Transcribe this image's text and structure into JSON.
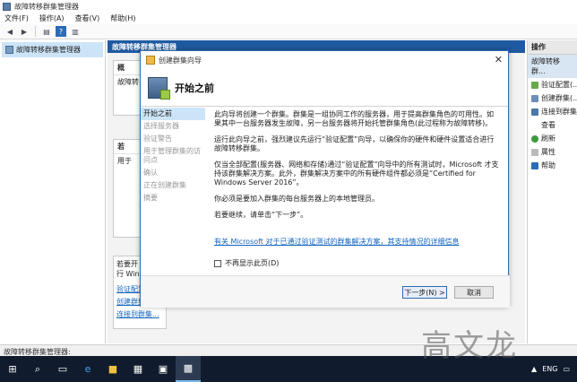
{
  "window": {
    "title": "故障转移群集管理器"
  },
  "menu": [
    "文件(F)",
    "操作(A)",
    "查看(V)",
    "帮助(H)"
  ],
  "tree": {
    "root": "故障转移群集管理器"
  },
  "center": {
    "header": "故障转移群集管理器",
    "panel_bottom": {
      "line1": "若要开",
      "line2": "行 Win",
      "links": [
        "验证配置...",
        "创建群集...",
        "连接到群集..."
      ]
    },
    "panel_top_label": "故障转",
    "marker1": "概",
    "marker2": "若",
    "marker3": "用于"
  },
  "actions": {
    "header": "操作",
    "sub": "故障转移群...",
    "items": [
      "验证配置(...",
      "创建群集(...",
      "连接到群集",
      "查看",
      "刷新",
      "属性",
      "帮助"
    ]
  },
  "statusbar": "故障转移群集管理器:",
  "taskbar": {
    "tray": "ENG",
    "time": "?"
  },
  "watermark": "高文龙",
  "wizard": {
    "title": "创建群集向导",
    "header": "开始之前",
    "steps": [
      "开始之前",
      "选择服务器",
      "验证警告",
      "用于管理群集的访问点",
      "确认",
      "正在创建群集",
      "摘要"
    ],
    "paragraphs": [
      "此向导将创建一个群集。群集是一组协同工作的服务器，用于提高群集角色的可用性。如果其中一台服务器发生故障，另一台服务器将开始托管群集角色(此过程称为故障转移)。",
      "运行此向导之前，强烈建议先运行“验证配置”向导，以确保你的硬件和硬件设置适合进行故障转移群集。",
      "仅当全部配置(服务器、网络和存储)通过“验证配置”向导中的所有测试时，Microsoft 才支持该群集解决方案。此外，群集解决方案中的所有硬件组件都必须是“Certified for Windows Server 2016”。",
      "你必须是要加入群集的每台服务器上的本地管理员。",
      "若要继续，请单击“下一步”。"
    ],
    "link": "有关 Microsoft 对于已通过验证测试的群集解决方案，其支持情况的详细信息",
    "checkbox": "不再显示此页(D)",
    "next": "下一步(N) >",
    "cancel": "取消"
  }
}
